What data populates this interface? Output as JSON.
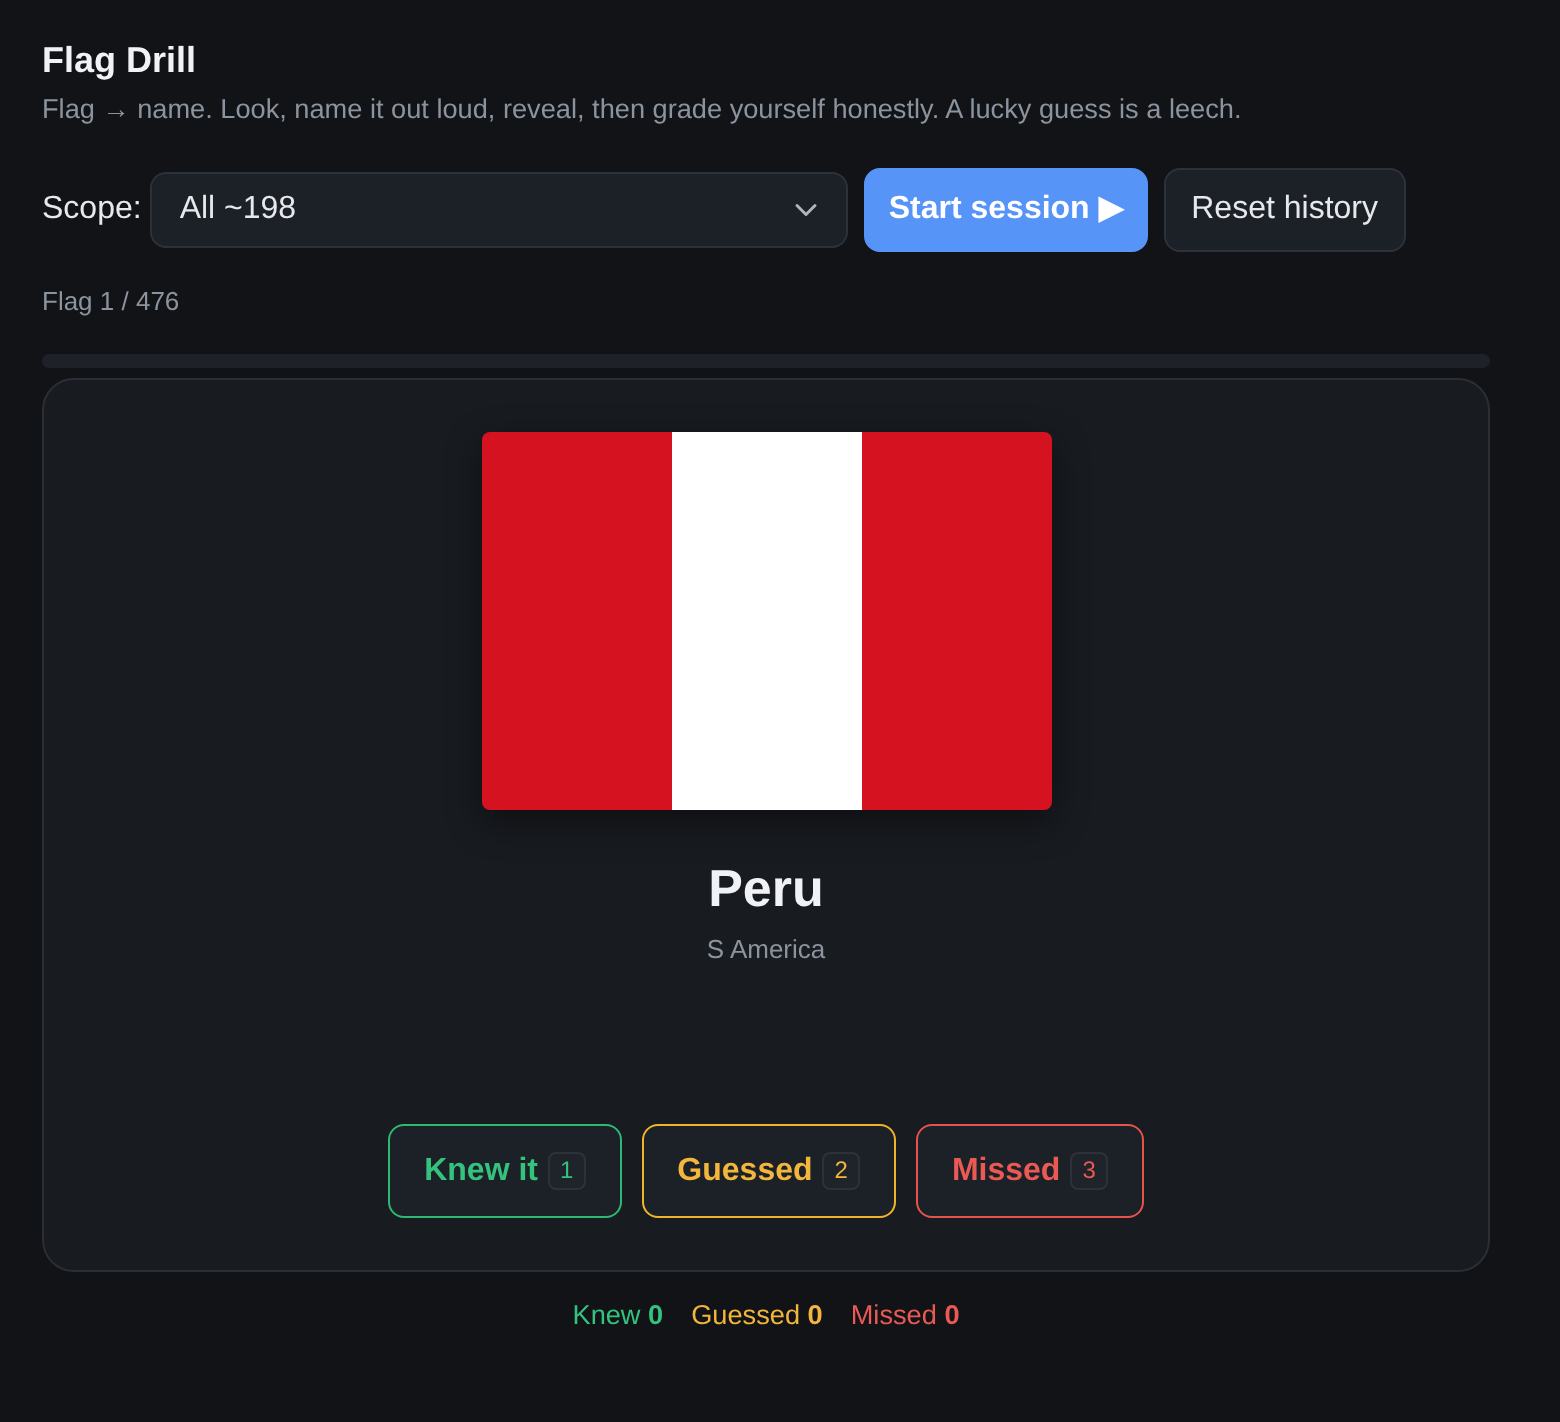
{
  "header": {
    "title": "Flag Drill",
    "subtitle": "Flag → name. Look, name it out loud, reveal, then grade yourself honestly. A lucky guess is a leech."
  },
  "controls": {
    "scope_label": "Scope:",
    "scope_value": "All ~198",
    "start_button": "Start session ▶",
    "reset_button": "Reset history"
  },
  "progress": {
    "text": "Flag 1 / 476",
    "level": 0
  },
  "card": {
    "flag": {
      "stripes": [
        {
          "color": "#d51220"
        },
        {
          "color": "#ffffff"
        },
        {
          "color": "#d51220"
        }
      ]
    },
    "name": "Peru",
    "region": "S America"
  },
  "grade_buttons": [
    {
      "kind": "knew",
      "label": "Knew it",
      "key": "1"
    },
    {
      "kind": "guessed",
      "label": "Guessed",
      "key": "2"
    },
    {
      "kind": "missed",
      "label": "Missed",
      "key": "3"
    }
  ],
  "tally": [
    {
      "kind": "knew",
      "label": "Knew",
      "count": "0"
    },
    {
      "kind": "guessed",
      "label": "Guessed",
      "count": "0"
    },
    {
      "kind": "missed",
      "label": "Missed",
      "count": "0"
    }
  ]
}
